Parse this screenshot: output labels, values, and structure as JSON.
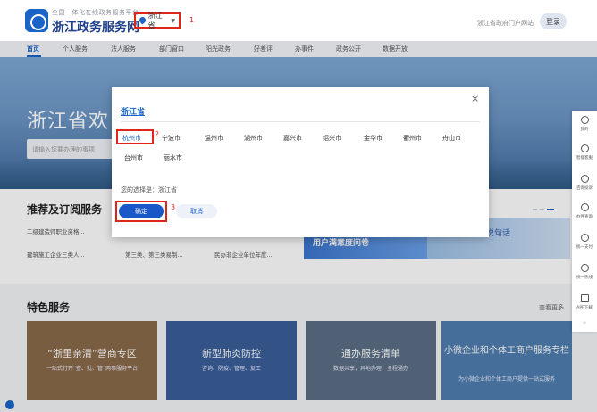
{
  "header": {
    "brand_sub": "全国一体化在线政务服务平台",
    "brand_title": "浙江政务服务网",
    "region_value": "浙江省",
    "step1": "1",
    "portal_link": "浙江省政府门户网站",
    "login_label": "登录"
  },
  "nav": {
    "items": [
      "首页",
      "个人服务",
      "法人服务",
      "部门窗口",
      "阳光政务",
      "好差评",
      "办事件",
      "政务公开",
      "数据开放"
    ]
  },
  "hero": {
    "title": "浙江省欢",
    "search_placeholder": "请输入您要办理的事项"
  },
  "recommend": {
    "title": "推荐及订阅服务",
    "items": [
      "二级建造师职业资格...",
      "建筑施工企业三类人...",
      "第三类、第三类易制...",
      "民办非企业单位年度..."
    ],
    "banner1": "用户满意度问卷",
    "banner2": "我向总理说句话"
  },
  "modal": {
    "close": "×",
    "province": "浙江省",
    "cities": [
      "杭州市",
      "宁波市",
      "温州市",
      "湖州市",
      "嘉兴市",
      "绍兴市",
      "金华市",
      "衢州市",
      "舟山市",
      "台州市",
      "丽水市"
    ],
    "step2": "2",
    "selected_text": "您的选择是：浙江省",
    "step3": "3",
    "confirm_label": "确定",
    "cancel_label": "取消"
  },
  "special": {
    "title": "特色服务",
    "more": "查看更多",
    "cards": [
      {
        "title": "“浙里亲清”营商专区",
        "sub": "一站式打开“查、批、管”两事服务平台",
        "color": "#8a6a4a"
      },
      {
        "title": "新型肺炎防控",
        "sub": "咨询、防疫、管理、复工",
        "color": "#3b5f9a"
      },
      {
        "title": "通办服务清单",
        "sub": "数据共享，异地办理，全程通办",
        "color": "#5c6f86"
      },
      {
        "title": "小微企业和个体工商户服务专栏",
        "sub": "为小微企业和个体工商户提供一站式服务",
        "color": "#4f7fb0"
      }
    ]
  },
  "float_bar": {
    "items": [
      "我的",
      "智能客服",
      "咨询投诉",
      "办件查询",
      "统一支付",
      "统一热线",
      "APP下载"
    ],
    "arrow": "»"
  },
  "colors": {
    "brand_blue": "#1a64c8",
    "highlight_red": "#e0251b"
  }
}
